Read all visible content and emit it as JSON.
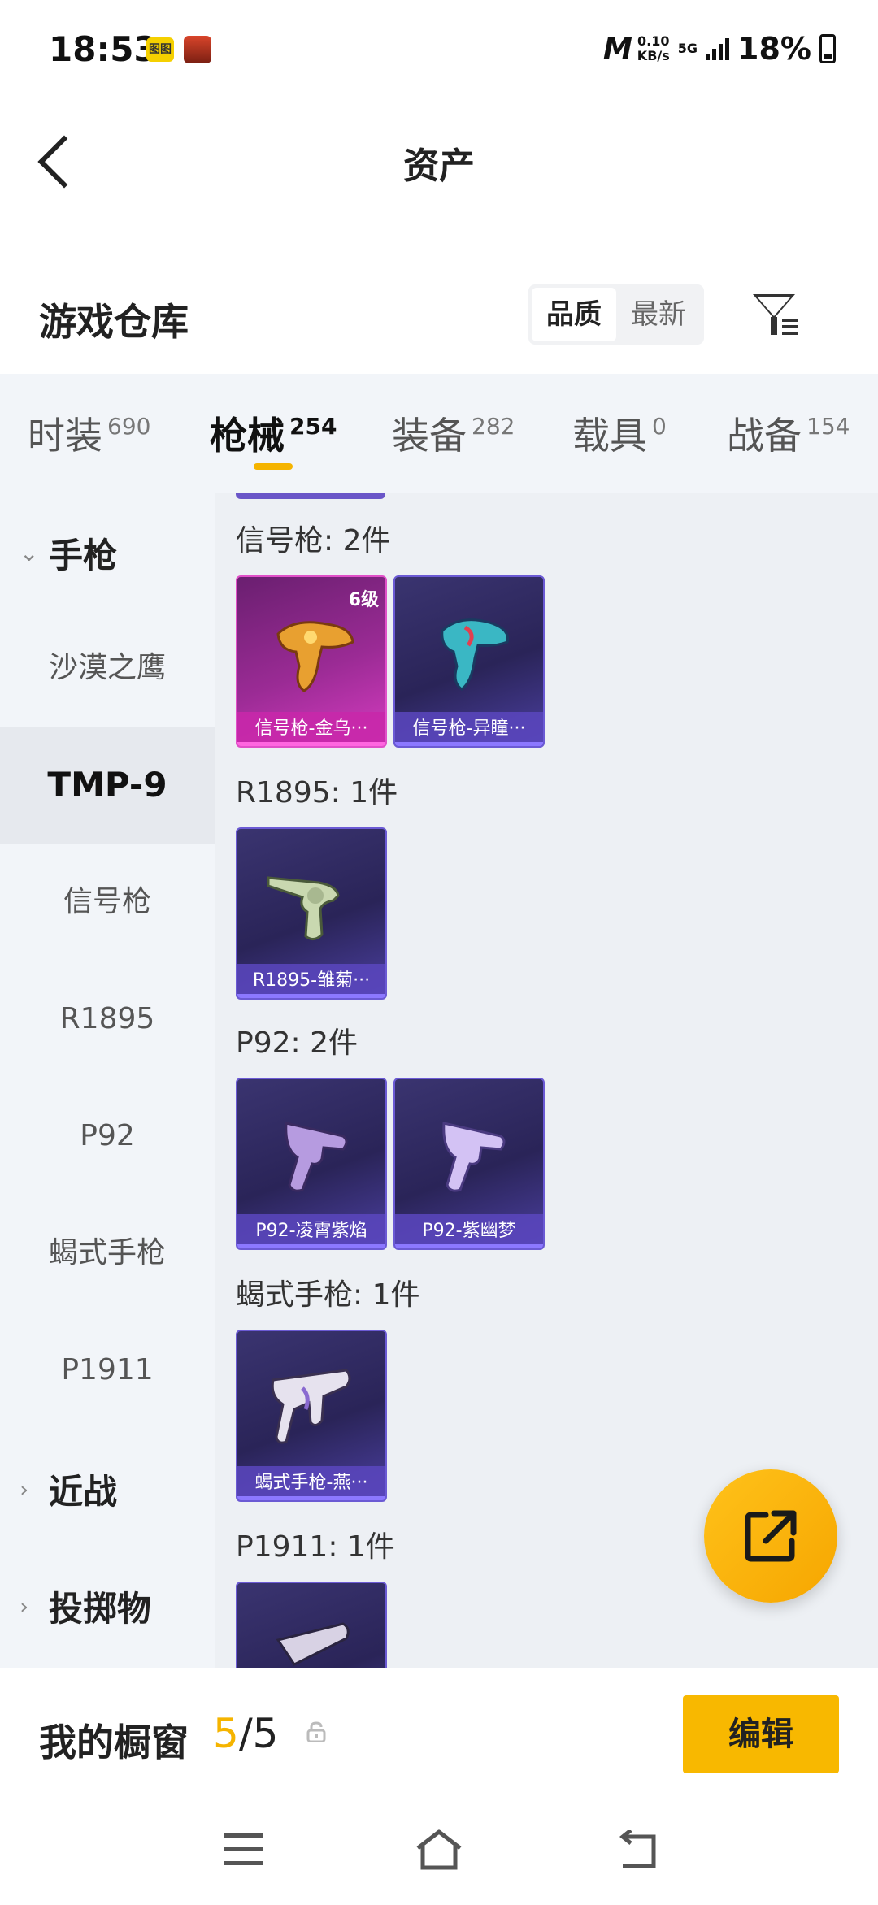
{
  "status_bar": {
    "time": "18:53",
    "app_icon_1": "图图",
    "network_speed": "0.10\nKB/s",
    "network_speed_value": "0.10",
    "network_speed_unit": "KB/s",
    "network_type": "5G",
    "battery_pct": "18%"
  },
  "header": {
    "title": "资产"
  },
  "warehouse": {
    "title": "游戏仓库",
    "sort_options": [
      "品质",
      "最新"
    ],
    "active_sort": "品质"
  },
  "tabs": [
    {
      "label": "时装",
      "count": "690"
    },
    {
      "label": "枪械",
      "count": "254",
      "active": true
    },
    {
      "label": "装备",
      "count": "282"
    },
    {
      "label": "载具",
      "count": "0"
    },
    {
      "label": "战备",
      "count": "154"
    }
  ],
  "sidebar": {
    "group_pistol": "手枪",
    "items": [
      "沙漠之鹰",
      "TMP-9",
      "信号枪",
      "R1895",
      "P92",
      "蝎式手枪",
      "P1911"
    ],
    "active_item": "TMP-9",
    "group_melee": "近战",
    "group_throwable": "投掷物"
  },
  "sections": [
    {
      "title": "信号枪: 2件",
      "cards": [
        {
          "caption": "信号枪-金乌···",
          "level": "6级",
          "rarity": "gold"
        },
        {
          "caption": "信号枪-异瞳···",
          "rarity": "purple"
        }
      ]
    },
    {
      "title": "R1895: 1件",
      "cards": [
        {
          "caption": "R1895-雏菊···",
          "rarity": "purple"
        }
      ]
    },
    {
      "title": "P92: 2件",
      "cards": [
        {
          "caption": "P92-凌霄紫焰",
          "rarity": "purple"
        },
        {
          "caption": "P92-紫幽梦",
          "rarity": "purple"
        }
      ]
    },
    {
      "title": "蝎式手枪: 1件",
      "cards": [
        {
          "caption": "蝎式手枪-燕···",
          "rarity": "purple"
        }
      ]
    },
    {
      "title": "P1911: 1件",
      "cards": []
    }
  ],
  "showcase": {
    "label": "我的橱窗",
    "current": "5",
    "separator": "/",
    "total": "5",
    "edit_label": "编辑"
  },
  "colors": {
    "accent": "#f8b800",
    "gold_card": "#d63cc0",
    "purple_card": "#4b3fa0"
  }
}
